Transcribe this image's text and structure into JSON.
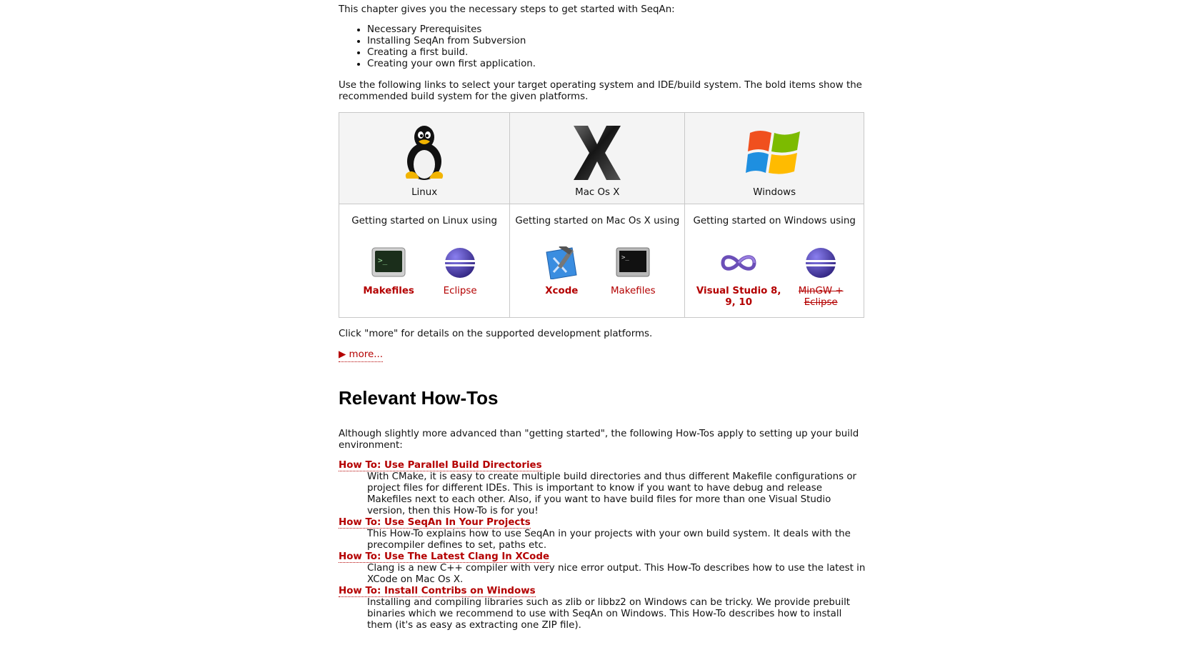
{
  "intro": {
    "text": "This chapter gives you the necessary steps to get started with SeqAn:",
    "steps": [
      "Necessary Prerequisites",
      "Installing SeqAn from Subversion",
      "Creating a first build.",
      "Creating your own first application."
    ],
    "links_text": "Use the following links to select your target operating system and IDE/build system. The bold items show the recommended build system for the given platforms."
  },
  "platforms": {
    "linux": {
      "name": "Linux",
      "start_text": "Getting started on Linux using",
      "ides": [
        {
          "label": "Makefiles",
          "icon": "terminal-icon"
        },
        {
          "label": "Eclipse",
          "icon": "eclipse-icon"
        }
      ]
    },
    "mac": {
      "name": "Mac Os X",
      "start_text": "Getting started on Mac Os X using",
      "ides": [
        {
          "label": "Xcode",
          "icon": "xcode-icon"
        },
        {
          "label": "Makefiles",
          "icon": "terminal-icon"
        }
      ]
    },
    "windows": {
      "name": "Windows",
      "start_text": "Getting started on Windows using",
      "ides": [
        {
          "label": "Visual Studio 8, 9, 10",
          "icon": "visual-studio-icon"
        },
        {
          "label": "MinGW + Eclipse",
          "icon": "eclipse-icon"
        }
      ]
    }
  },
  "more_section": {
    "text": "Click \"more\" for details on the supported development platforms.",
    "link": "▶ more..."
  },
  "howtos": {
    "heading": "Relevant How-Tos",
    "intro": "Although slightly more advanced than \"getting started\", the following How-Tos apply to setting up your build environment:",
    "items": [
      {
        "title": "How To: Use Parallel Build Directories",
        "desc": "With CMake, it is easy to create multiple build directories and thus different Makefile configurations or project files for different IDEs. This is important to know if you want to have debug and release Makefiles next to each other. Also, if you want to have build files for more than one Visual Studio version, then this How-To is for you!"
      },
      {
        "title": "How To: Use SeqAn In Your Projects",
        "desc": "This How-To explains how to use SeqAn in your projects with your own build system. It deals with the precompiler defines to set, paths etc."
      },
      {
        "title": "How To: Use The Latest Clang In XCode",
        "desc": "Clang is a new C++ compiler with very nice error output. This How-To describes how to use the latest in XCode on Mac Os X."
      },
      {
        "title": "How To: Install Contribs on Windows",
        "desc": "Installing and compiling libraries such as zlib or libbz2 on Windows can be tricky. We provide prebuilt binaries which we recommend to use with SeqAn on Windows. This How-To describes how to install them (it's as easy as extracting one ZIP file)."
      }
    ]
  },
  "colors": {
    "link": "#b40000",
    "table_border": "#c8c8c8",
    "os_cell_bg": "#f4f4f4"
  }
}
